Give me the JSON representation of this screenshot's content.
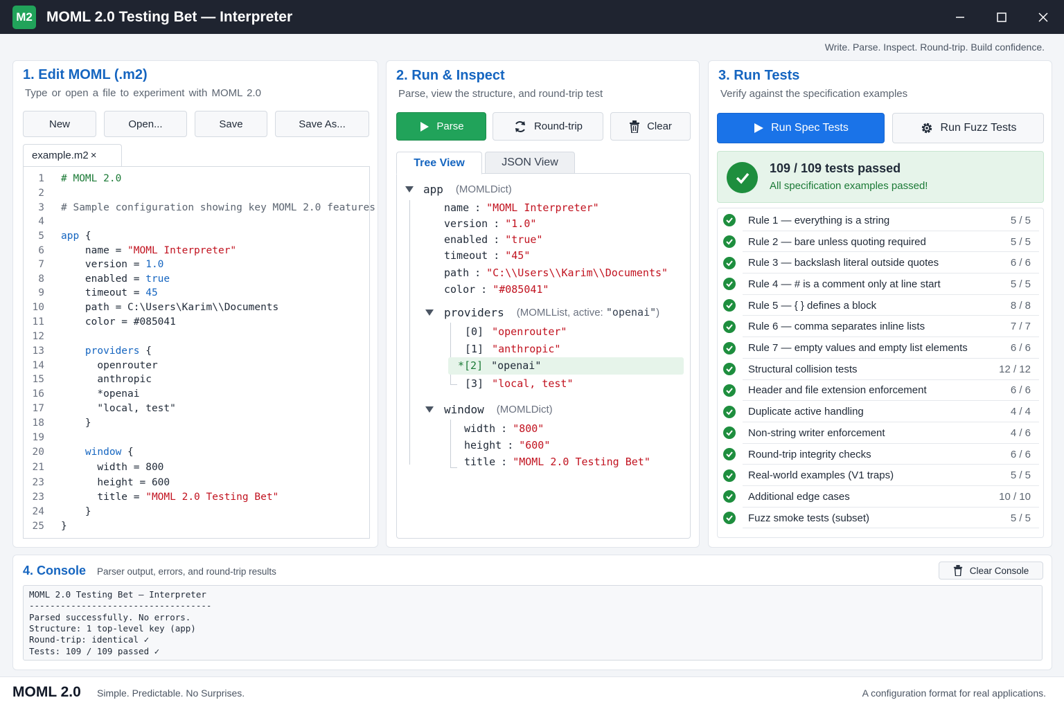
{
  "window": {
    "icon_label": "M2",
    "title": "MOML 2.0 Testing Bet — Interpreter"
  },
  "tagline": "Write. Parse. Inspect. Round-trip. Build confidence.",
  "edit_panel": {
    "title": "1. Edit MOML (.m2)",
    "subtitle": "Type or open a file to experiment with MOML 2.0",
    "buttons": {
      "new": "New",
      "open": "Open...",
      "save": "Save",
      "save_as": "Save As..."
    },
    "file_tab": "example.m2",
    "file_tab_close": "×",
    "line_numbers": [
      "1",
      "2",
      "3",
      "4",
      "5",
      "6",
      "7",
      "8",
      "9",
      "10",
      "11",
      "12",
      "13",
      "14",
      "15",
      "16",
      "17",
      "18",
      "19",
      "20",
      "21",
      "23",
      "23",
      "24",
      "25"
    ]
  },
  "run_panel": {
    "title": "2. Run & Inspect",
    "subtitle": "Parse, view the structure, and round-trip test",
    "buttons": {
      "parse": "Parse",
      "round_trip": "Round-trip",
      "clear": "Clear"
    },
    "tabs": {
      "tree": "Tree View",
      "json": "JSON View"
    },
    "tree": {
      "root_key": "app",
      "root_type": "(MOMLDict)",
      "name_key": "name",
      "name_val": "\"MOML Interpreter\"",
      "version_key": "version",
      "version_val": "\"1.0\"",
      "enabled_key": "enabled",
      "enabled_val": "\"true\"",
      "timeout_key": "timeout",
      "timeout_val": "\"45\"",
      "path_key": "path",
      "path_val": "\"C:\\\\Users\\\\Karim\\\\Documents\"",
      "color_key": "color",
      "color_val": "\"#085041\"",
      "providers_key": "providers",
      "providers_type": "(MOMLList, active: ",
      "providers_active": "\"openai\"",
      "providers_close": ")",
      "p0_idx": "[0]",
      "p0_val": "\"openrouter\"",
      "p1_idx": "[1]",
      "p1_val": "\"anthropic\"",
      "p2_idx": "*[2]",
      "p2_val": "\"openai\"",
      "p3_idx": "[3]",
      "p3_val": "\"local, test\"",
      "window_key": "window",
      "window_type": "(MOMLDict)",
      "width_key": "width",
      "width_val": "\"800\"",
      "height_key": "height",
      "height_val": "\"600\"",
      "title_key": "title",
      "title_val": "\"MOML 2.0 Testing Bet\"",
      "sep": ":"
    }
  },
  "tests_panel": {
    "title": "3. Run Tests",
    "subtitle": "Verify against the specification examples",
    "buttons": {
      "spec": "Run Spec Tests",
      "fuzz": "Run Fuzz Tests"
    },
    "summary_title": "109 / 109 tests passed",
    "summary_sub": "All specification examples passed!",
    "tests": [
      {
        "name": "Rule 1 — everything is a string",
        "count": "5 / 5"
      },
      {
        "name": "Rule 2 — bare unless quoting required",
        "count": "5 / 5"
      },
      {
        "name": "Rule 3 — backslash literal outside quotes",
        "count": "6 / 6"
      },
      {
        "name": "Rule 4 — # is a comment only at line start",
        "count": "5 / 5"
      },
      {
        "name": "Rule 5 — { } defines a block",
        "count": "8 / 8"
      },
      {
        "name": "Rule 6 — comma separates inline lists",
        "count": "7 / 7"
      },
      {
        "name": "Rule 7 — empty values and empty list elements",
        "count": "6 / 6"
      },
      {
        "name": "Structural collision tests",
        "count": "12 / 12"
      },
      {
        "name": "Header and file extension enforcement",
        "count": "6 / 6"
      },
      {
        "name": "Duplicate active handling",
        "count": "4 / 4"
      },
      {
        "name": "Non-string writer enforcement",
        "count": "4 / 6"
      },
      {
        "name": "Round-trip integrity checks",
        "count": "6 / 6"
      },
      {
        "name": "Real-world examples (V1 traps)",
        "count": "5 / 5"
      },
      {
        "name": "Additional edge cases",
        "count": "10 / 10"
      },
      {
        "name": "Fuzz smoke tests (subset)",
        "count": "5 / 5"
      }
    ]
  },
  "console": {
    "title": "4. Console",
    "subtitle": "Parser output, errors, and round-trip results",
    "clear_button": "Clear Console",
    "lines": [
      "MOML 2.0 Testing Bet — Interpreter",
      "-----------------------------------",
      "Parsed successfully. No errors.",
      "Structure: 1 top-level key (app)",
      "Round-trip: identical ✓",
      "Tests: 109 / 109 passed ✓"
    ]
  },
  "footer": {
    "brand": "MOML 2.0",
    "slogan": "Simple. Predictable. No Surprises.",
    "right": "A configuration format for real applications."
  },
  "colors": {
    "accent": "#1565c0",
    "success": "#1e8e3e",
    "parse_button": "#21a35a",
    "spec_button": "#1a73e8"
  }
}
